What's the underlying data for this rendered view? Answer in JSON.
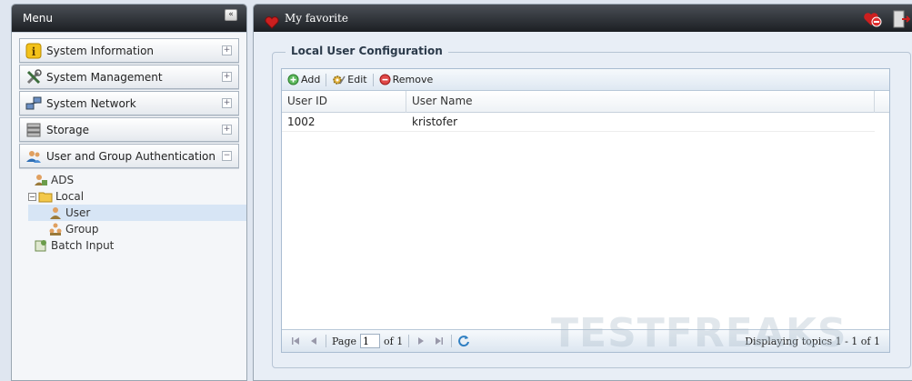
{
  "menu": {
    "title": "Menu",
    "collapse_glyph": "«",
    "sections": [
      {
        "label": "System Information",
        "icon": "info-icon",
        "toggle": "+"
      },
      {
        "label": "System Management",
        "icon": "tools-icon",
        "toggle": "+"
      },
      {
        "label": "System Network",
        "icon": "network-icon",
        "toggle": "+"
      },
      {
        "label": "Storage",
        "icon": "storage-icon",
        "toggle": "+"
      },
      {
        "label": "User and Group Authentication",
        "icon": "users-icon",
        "toggle": "−"
      }
    ],
    "tree": {
      "ads": "ADS",
      "local": "Local",
      "local_toggle": "−",
      "user": "User",
      "group": "Group",
      "batch_input": "Batch Input"
    }
  },
  "header": {
    "favorite_label": "My favorite"
  },
  "config": {
    "legend": "Local User Configuration",
    "toolbar": {
      "add": "Add",
      "edit": "Edit",
      "remove": "Remove"
    },
    "columns": [
      "User ID",
      "User Name"
    ],
    "rows": [
      {
        "user_id": "1002",
        "user_name": "kristofer"
      }
    ],
    "pager": {
      "page_label": "Page",
      "page_value": "1",
      "of_label": "of 1",
      "status": "Displaying topics 1 - 1 of 1"
    }
  },
  "watermark": "TESTFREAKS",
  "colors": {
    "header_dark": "#1c1f23",
    "selected_row": "#d7e5f5",
    "accent_red": "#cc1f1f"
  }
}
